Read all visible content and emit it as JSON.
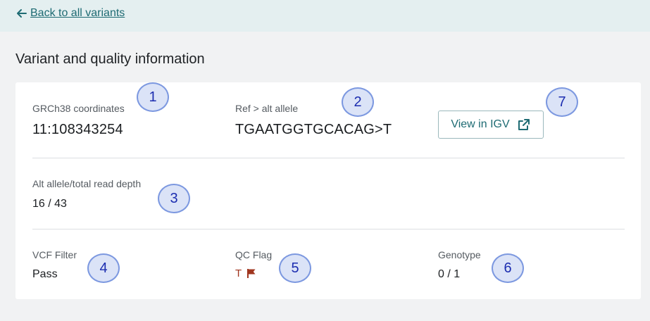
{
  "nav": {
    "back_label": "Back to all variants"
  },
  "page": {
    "title": "Variant and quality information"
  },
  "fields": {
    "coordinates": {
      "label": "GRCh38 coordinates",
      "value": "11:108343254"
    },
    "allele": {
      "label": "Ref > alt allele",
      "value": "TGAATGGTGCACAG>T"
    },
    "igv_button": {
      "label": "View in IGV",
      "icon": "external-link-icon"
    },
    "read_depth": {
      "label": "Alt allele/total read depth",
      "value": "16 / 43"
    },
    "vcf_filter": {
      "label": "VCF Filter",
      "value": "Pass"
    },
    "qc_flag": {
      "label": "QC Flag",
      "value": "T",
      "icon": "flag-icon",
      "color": "#a0361f"
    },
    "genotype": {
      "label": "Genotype",
      "value": "0 / 1"
    }
  },
  "callouts": [
    "1",
    "2",
    "3",
    "4",
    "5",
    "6",
    "7"
  ],
  "colors": {
    "accent": "#1e6b73",
    "topbar": "#e4eff0",
    "callout_fill": "#dbe3f7",
    "callout_border": "#7c98e0",
    "callout_text": "#1c2db0"
  }
}
